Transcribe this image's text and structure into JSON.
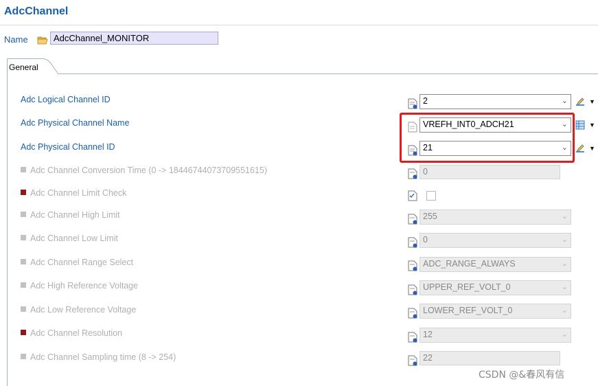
{
  "header": {
    "title": "AdcChannel"
  },
  "name_row": {
    "label": "Name",
    "value": "AdcChannel_MONITOR",
    "icon": "folder-icon"
  },
  "tabs": [
    {
      "label": "General",
      "active": true
    }
  ],
  "rows": [
    {
      "label": "Adc Logical Channel ID",
      "value": "2",
      "type": "combo",
      "enabled": true
    },
    {
      "label": "Adc Physical Channel Name",
      "value": "VREFH_INT0_ADCH21",
      "type": "combo",
      "enabled": true
    },
    {
      "label": "Adc Physical Channel ID",
      "value": "21",
      "type": "combo",
      "enabled": true
    },
    {
      "label": "Adc Channel Conversion Time (0 -> 18446744073709551615)",
      "value": "0",
      "type": "text",
      "enabled": false
    },
    {
      "label": "Adc Channel Limit Check",
      "value": "",
      "type": "checkbox",
      "enabled": false,
      "checked": false
    },
    {
      "label": "Adc Channel High Limit",
      "value": "255",
      "type": "combo",
      "enabled": false
    },
    {
      "label": "Adc Channel Low Limit",
      "value": "0",
      "type": "combo",
      "enabled": false
    },
    {
      "label": "Adc Channel Range Select",
      "value": "ADC_RANGE_ALWAYS",
      "type": "combo",
      "enabled": false
    },
    {
      "label": "Adc High Reference Voltage",
      "value": "UPPER_REF_VOLT_0",
      "type": "combo",
      "enabled": false
    },
    {
      "label": "Adc Low Reference Voltage",
      "value": "LOWER_REF_VOLT_0",
      "type": "combo",
      "enabled": false
    },
    {
      "label": "Adc Channel Resolution",
      "value": "12",
      "type": "combo",
      "enabled": false
    },
    {
      "label": "Adc Channel Sampling time (8 -> 254)",
      "value": "22",
      "type": "text",
      "enabled": false
    }
  ],
  "colors": {
    "accent": "#1a5fa8",
    "highlight_border": "#e11b1b",
    "disabled_text": "#b0b0b0"
  },
  "watermark": "CSDN @&春风有信"
}
